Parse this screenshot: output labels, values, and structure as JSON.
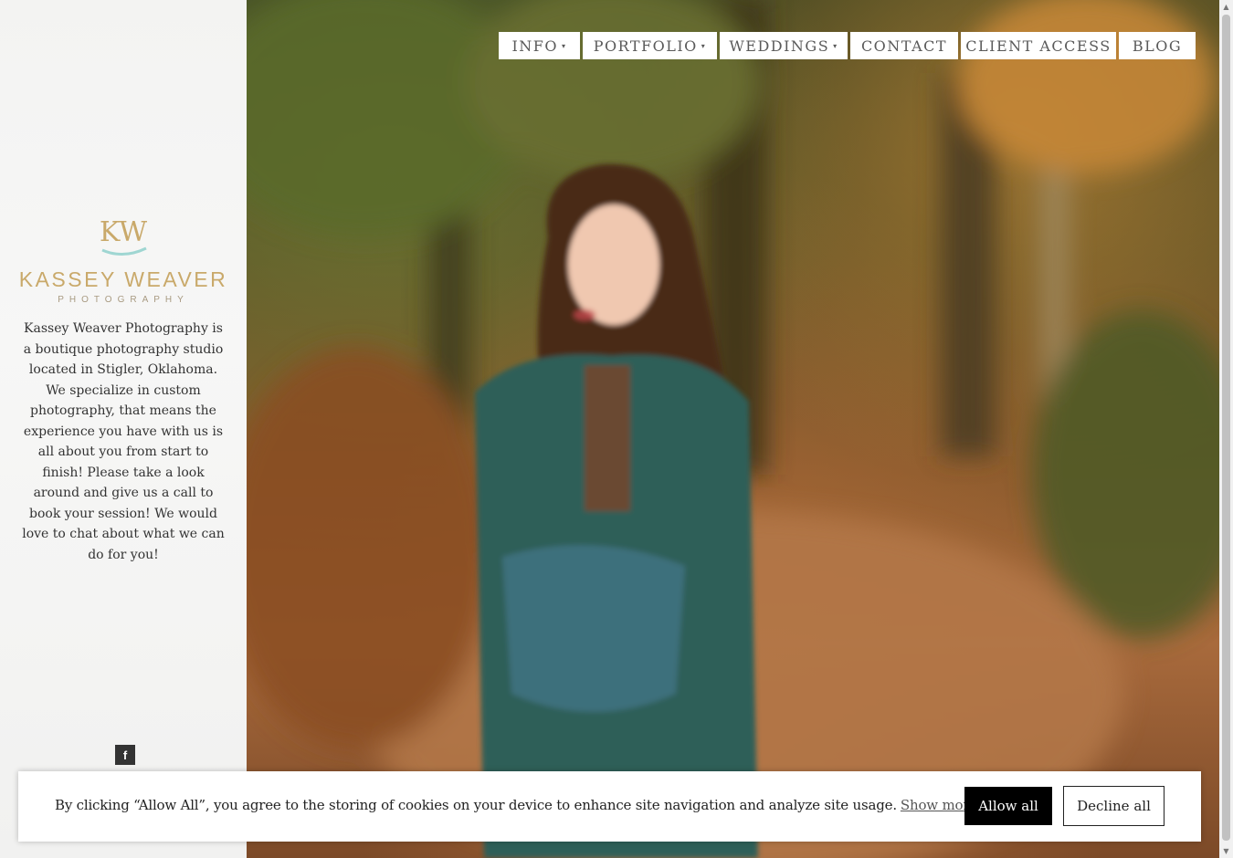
{
  "sidebar": {
    "logo": {
      "monogram": "KW",
      "name": "KASSEY WEAVER",
      "tagline": "PHOTOGRAPHY",
      "gold_color": "#c9a96a",
      "teal_color": "#9fd6d2"
    },
    "about_text": "Kassey Weaver Photography is a boutique photography studio located in Stigler, Oklahoma. We specialize in custom photography, that means the experience you have with us is all about you from start to finish! Please take a look around and give us a call to book your session! We would love to chat about what we can do for you!",
    "social": {
      "facebook_icon": "f"
    }
  },
  "nav": {
    "items": [
      {
        "label": "INFO",
        "dropdown": true
      },
      {
        "label": "PORTFOLIO",
        "dropdown": true
      },
      {
        "label": "WEDDINGS",
        "dropdown": true
      },
      {
        "label": "CONTACT",
        "dropdown": false
      },
      {
        "label": "CLIENT ACCESS",
        "dropdown": false
      },
      {
        "label": "BLOG",
        "dropdown": false
      }
    ],
    "caret": "▾"
  },
  "cookie": {
    "message": "By clicking “Allow All”, you agree to the storing of cookies on your device to enhance site navigation and analyze site usage.",
    "link": "Show more.",
    "allow": "Allow all",
    "decline": "Decline all"
  }
}
